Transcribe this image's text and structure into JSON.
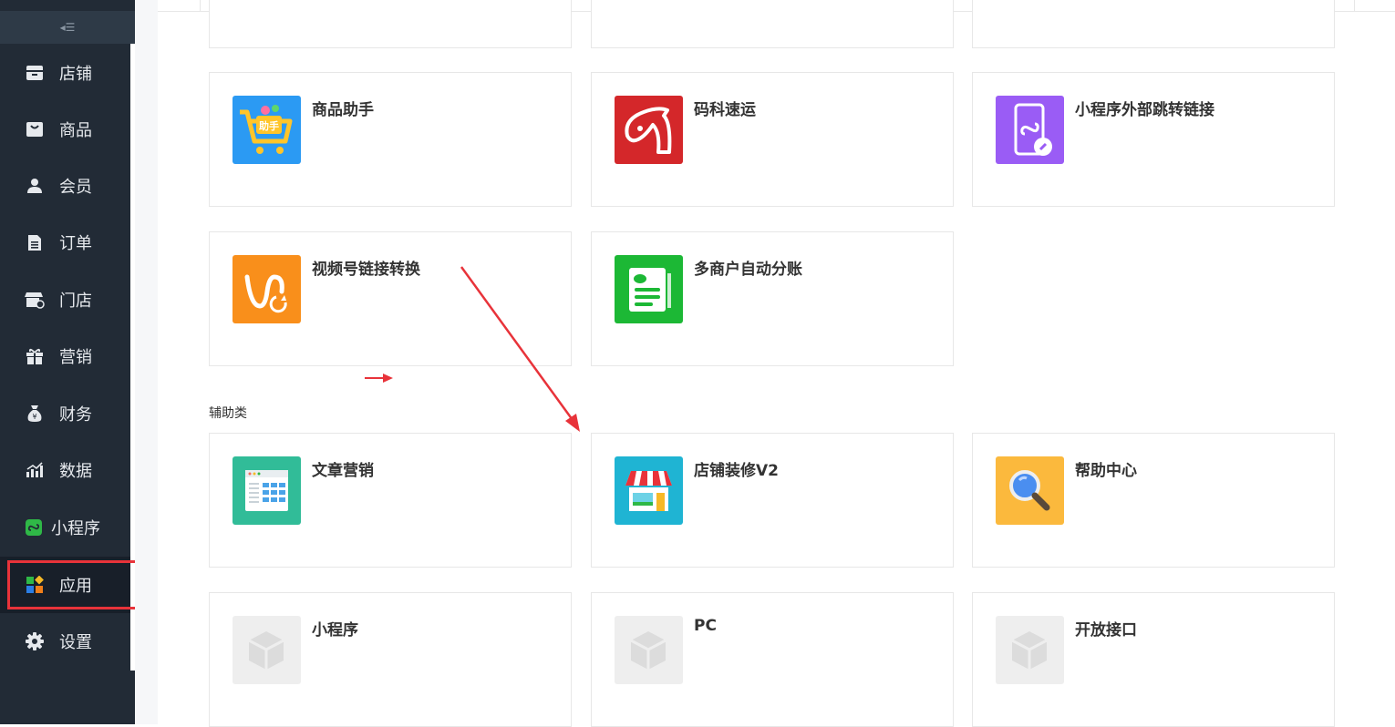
{
  "sidebar": {
    "collapse_glyph": "◂☰",
    "items": [
      {
        "label": "店铺",
        "icon": "store-icon"
      },
      {
        "label": "商品",
        "icon": "product-icon"
      },
      {
        "label": "会员",
        "icon": "member-icon"
      },
      {
        "label": "订单",
        "icon": "order-icon"
      },
      {
        "label": "门店",
        "icon": "shop-icon"
      },
      {
        "label": "营销",
        "icon": "gift-icon"
      },
      {
        "label": "财务",
        "icon": "money-bag-icon"
      },
      {
        "label": "数据",
        "icon": "chart-icon"
      },
      {
        "label": "小程序",
        "icon": "mini-program-icon"
      },
      {
        "label": "应用",
        "icon": "apps-icon",
        "active": true
      },
      {
        "label": "设置",
        "icon": "gear-icon"
      }
    ]
  },
  "apps_row1": [
    {
      "label": "商品助手",
      "icon": "cart-helper-icon",
      "color": "#2b9af3"
    },
    {
      "label": "码科速运",
      "icon": "horse-icon",
      "color": "#d4272a"
    },
    {
      "label": "小程序外部跳转链接",
      "icon": "phone-link-icon",
      "color": "#9a5cf5"
    }
  ],
  "apps_row2": [
    {
      "label": "视频号链接转换",
      "icon": "video-link-icon",
      "color": "#f98f1b"
    },
    {
      "label": "多商户自动分账",
      "icon": "split-bill-icon",
      "color": "#1cb835"
    }
  ],
  "section": {
    "title": "辅助类"
  },
  "apps_row3": [
    {
      "label": "文章营销",
      "icon": "article-icon",
      "color": "#31bc98"
    },
    {
      "label": "店铺装修V2",
      "icon": "storefront-icon",
      "color": "#1fb4d3"
    },
    {
      "label": "帮助中心",
      "icon": "magnifier-icon",
      "color": "#fbb93d"
    }
  ],
  "apps_row4": [
    {
      "label": "小程序",
      "icon": "box-icon",
      "color": "#eeeeee"
    },
    {
      "label": "PC",
      "icon": "box-icon",
      "color": "#eeeeee"
    },
    {
      "label": "开放接口",
      "icon": "box-icon",
      "color": "#eeeeee"
    }
  ],
  "colors": {
    "sidebar_bg": "#222b36",
    "annotation_red": "#e8333a"
  }
}
